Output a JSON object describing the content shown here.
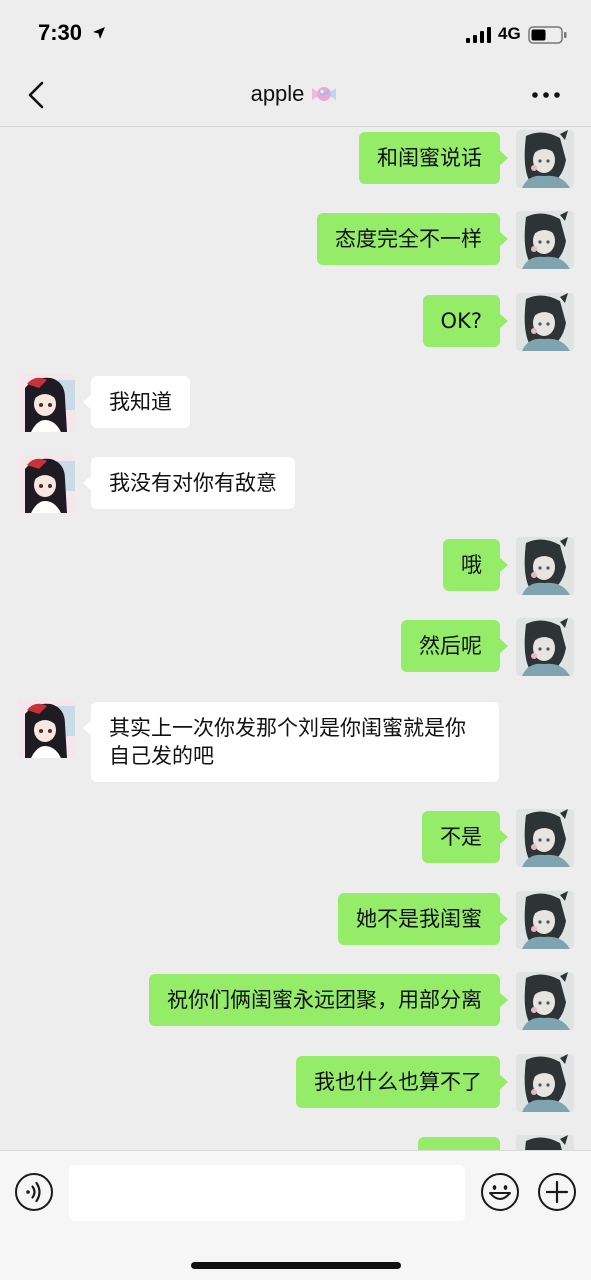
{
  "status_bar": {
    "time": "7:30",
    "network": "4G"
  },
  "header": {
    "title": "apple",
    "title_icon": "candy-icon"
  },
  "messages": [
    {
      "side": "me",
      "text": "和闺蜜说话"
    },
    {
      "side": "me",
      "text": "态度完全不一样"
    },
    {
      "side": "me",
      "text": "OK?"
    },
    {
      "side": "them",
      "text": "我知道"
    },
    {
      "side": "them",
      "text": "我没有对你有敌意"
    },
    {
      "side": "me",
      "text": "哦"
    },
    {
      "side": "me",
      "text": "然后呢"
    },
    {
      "side": "them",
      "text": "其实上一次你发那个刘是你闺蜜就是你自己发的吧"
    },
    {
      "side": "me",
      "text": "不是"
    },
    {
      "side": "me",
      "text": "她不是我闺蜜"
    },
    {
      "side": "me",
      "text": "祝你们俩闺蜜永远团聚，用部分离"
    },
    {
      "side": "me",
      "text": "我也什么也算不了"
    },
    {
      "side": "me",
      "text": ""
    }
  ],
  "input": {
    "value": "",
    "placeholder": ""
  },
  "colors": {
    "my_bubble": "#95ec69",
    "their_bubble": "#ffffff",
    "background": "#ededed"
  }
}
